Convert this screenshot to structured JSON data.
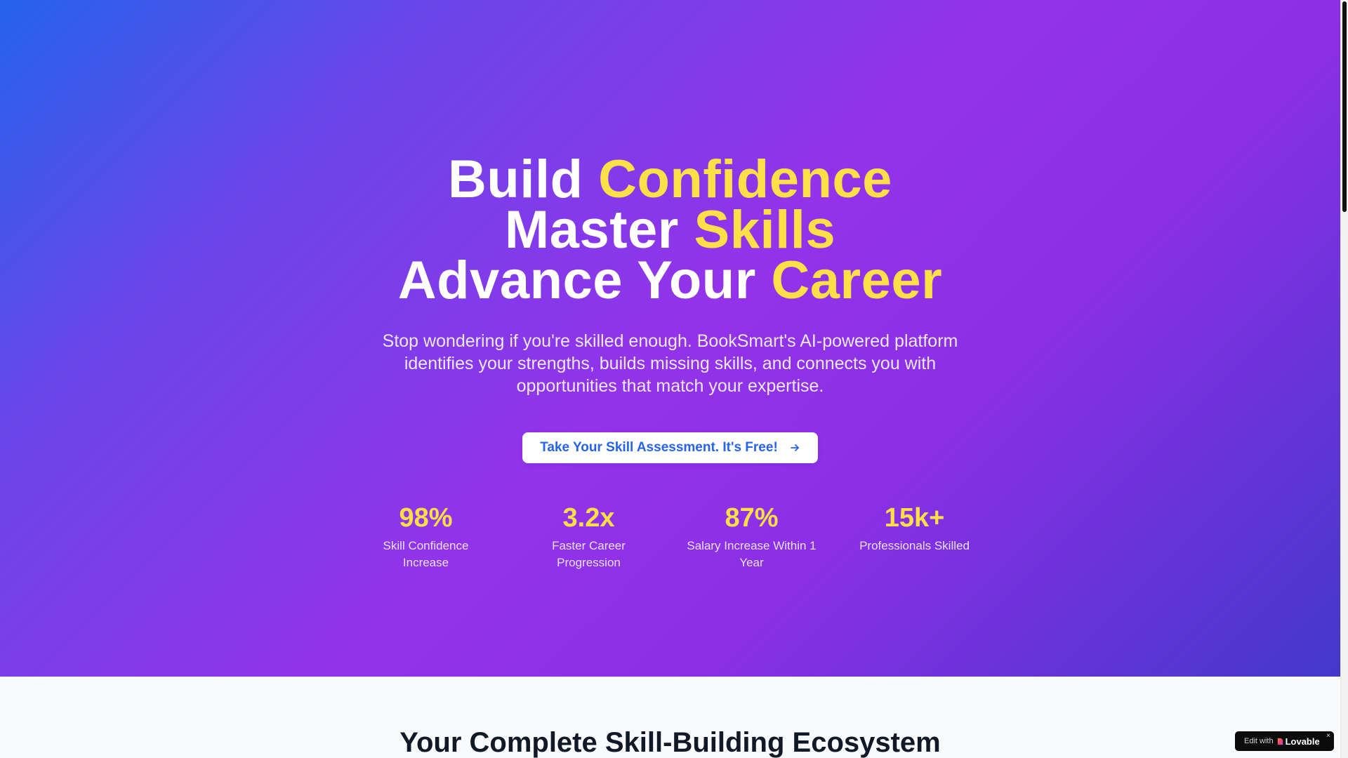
{
  "hero": {
    "headline": {
      "line1": {
        "plain": "Build ",
        "highlight": "Confidence"
      },
      "line2": {
        "plain": "Master ",
        "highlight": "Skills"
      },
      "line3": {
        "plain": "Advance Your ",
        "highlight": "Career"
      }
    },
    "subtitle": "Stop wondering if you're skilled enough. BookSmart's AI-powered platform identifies your strengths, builds missing skills, and connects you with opportunities that match your expertise.",
    "cta": {
      "label": "Take Your Skill Assessment. It's Free!",
      "icon": "arrow-right-icon"
    },
    "stats": [
      {
        "value": "98%",
        "label": "Skill Confidence Increase"
      },
      {
        "value": "3.2x",
        "label": "Faster Career Progression"
      },
      {
        "value": "87%",
        "label": "Salary Increase Within 1 Year"
      },
      {
        "value": "15k+",
        "label": "Professionals Skilled"
      }
    ]
  },
  "section": {
    "title": "Your Complete Skill-Building Ecosystem"
  },
  "badge": {
    "prefix": "Edit with",
    "brand": "Lovable",
    "icon": "heart-icon",
    "close": "×"
  },
  "colors": {
    "accent_yellow": "#fde047",
    "cta_text": "#2563eb",
    "gradient_start": "#2563eb",
    "gradient_mid": "#9333ea",
    "gradient_end": "#4338ca"
  }
}
